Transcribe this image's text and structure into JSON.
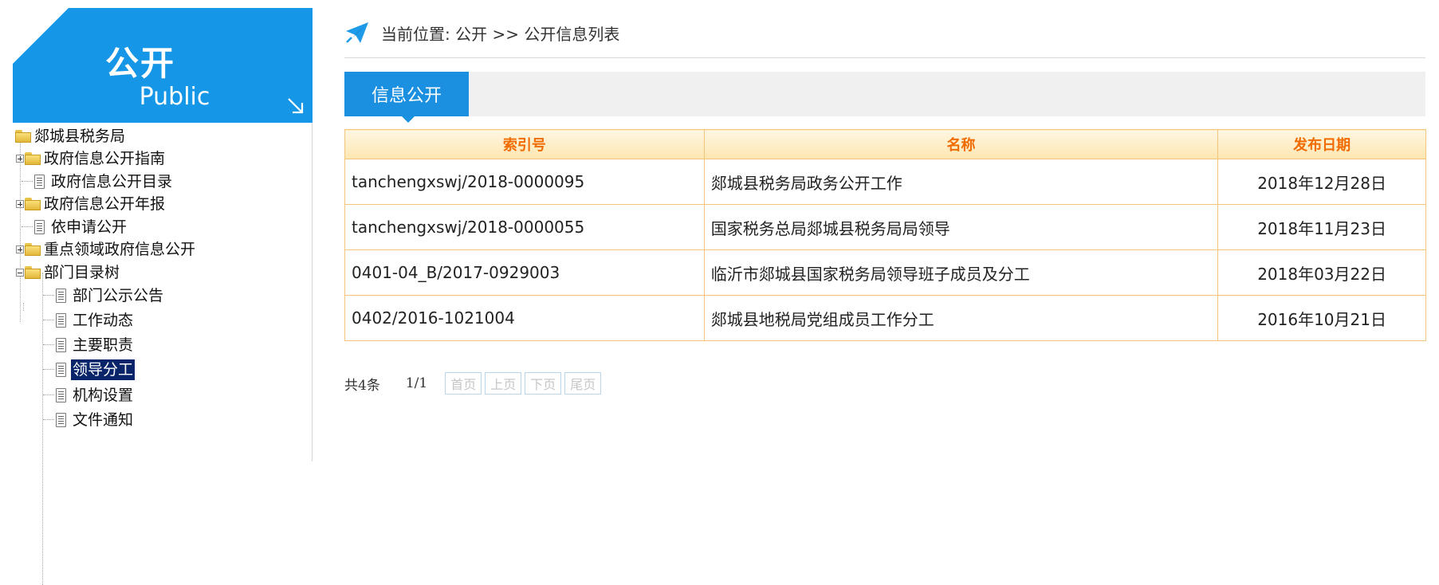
{
  "banner": {
    "title": "公开",
    "subtitle": "Public"
  },
  "tree": {
    "root": "郯城县税务局",
    "items": [
      "政府信息公开指南",
      "政府信息公开目录",
      "政府信息公开年报",
      "依申请公开",
      "重点领域政府信息公开",
      "部门目录树"
    ],
    "children": [
      "部门公示公告",
      "工作动态",
      "主要职责",
      "领导分工",
      "机构设置",
      "文件通知"
    ],
    "selected": "领导分工"
  },
  "breadcrumb": {
    "text": "当前位置: 公开 >> 公开信息列表"
  },
  "tab": {
    "label": "信息公开"
  },
  "table": {
    "headers": [
      "索引号",
      "名称",
      "发布日期"
    ],
    "rows": [
      [
        "tanchengxswj/2018-0000095",
        "郯城县税务局政务公开工作",
        "2018年12月28日"
      ],
      [
        "tanchengxswj/2018-0000055",
        "国家税务总局郯城县税务局局领导",
        "2018年11月23日"
      ],
      [
        "0401-04_B/2017-0929003",
        "临沂市郯城县国家税务局领导班子成员及分工",
        "2018年03月22日"
      ],
      [
        "0402/2016-1021004",
        "郯城县地税局党组成员工作分工",
        "2016年10月21日"
      ]
    ]
  },
  "pager": {
    "total": "共4条",
    "page": "1/1",
    "first": "首页",
    "prev": "上页",
    "next": "下页",
    "last": "尾页"
  },
  "colors": {
    "brand": "#1696e6",
    "header_text": "#f06b00",
    "border": "#f3c47a",
    "selected": "#0a246a"
  },
  "icons": [
    "arrow-down-right-icon",
    "paper-plane-icon",
    "folder-icon",
    "document-icon",
    "expand-icon",
    "collapse-icon"
  ]
}
